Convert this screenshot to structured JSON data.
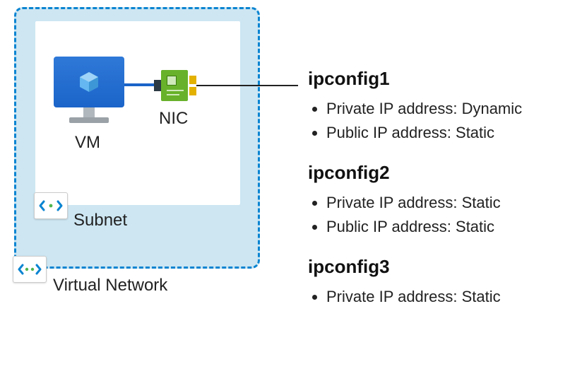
{
  "vnet": {
    "label": "Virtual Network"
  },
  "subnet": {
    "label": "Subnet"
  },
  "vm": {
    "label": "VM"
  },
  "nic": {
    "label": "NIC"
  },
  "configs": [
    {
      "name": "ipconfig1",
      "items": [
        "Private IP address: Dynamic",
        "Public IP address: Static"
      ]
    },
    {
      "name": "ipconfig2",
      "items": [
        "Private IP address: Static",
        "Public IP address: Static"
      ]
    },
    {
      "name": "ipconfig3",
      "items": [
        "Private IP address: Static"
      ]
    }
  ]
}
